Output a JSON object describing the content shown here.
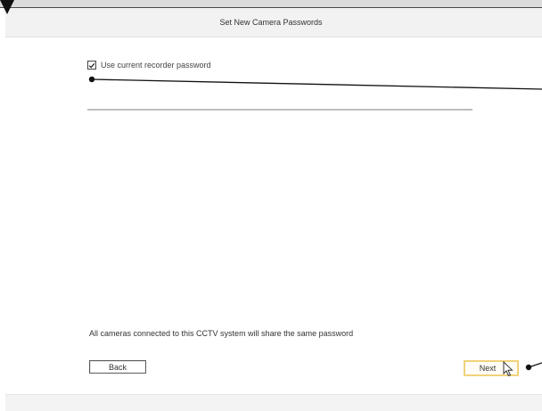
{
  "dialog": {
    "title": "Set New Camera Passwords",
    "checkbox": {
      "label": "Use current recorder password",
      "checked": true
    },
    "footnote": "All cameras connected to this CCTV system will share the same password"
  },
  "buttons": {
    "back_label": "Back",
    "next_label": "Next"
  },
  "icons": {
    "checkmark": "check-icon",
    "cursor": "mouse-pointer-icon",
    "marker": "triangle-marker-icon"
  },
  "colors": {
    "title_bar": "#f2f2f2",
    "next_highlight": "#f0d27a",
    "callout_line": "#111111"
  }
}
